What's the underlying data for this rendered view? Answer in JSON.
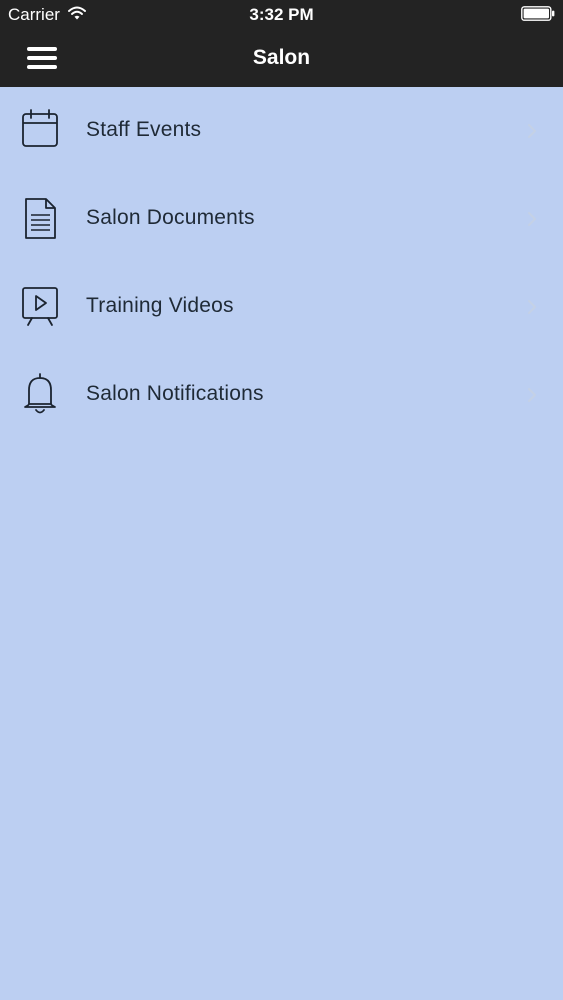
{
  "status_bar": {
    "carrier": "Carrier",
    "time": "3:32 PM",
    "wifi_icon": "wifi-icon",
    "battery_icon": "battery-icon"
  },
  "nav_bar": {
    "title": "Salon",
    "menu_icon": "hamburger-menu-icon",
    "background_color": "#232323"
  },
  "content": {
    "background_color": "#bccff2",
    "items": [
      {
        "label": "Staff Events",
        "icon": "calendar-icon"
      },
      {
        "label": "Salon Documents",
        "icon": "document-icon"
      },
      {
        "label": "Training Videos",
        "icon": "video-presentation-icon"
      },
      {
        "label": "Salon Notifications",
        "icon": "bell-icon"
      }
    ]
  }
}
